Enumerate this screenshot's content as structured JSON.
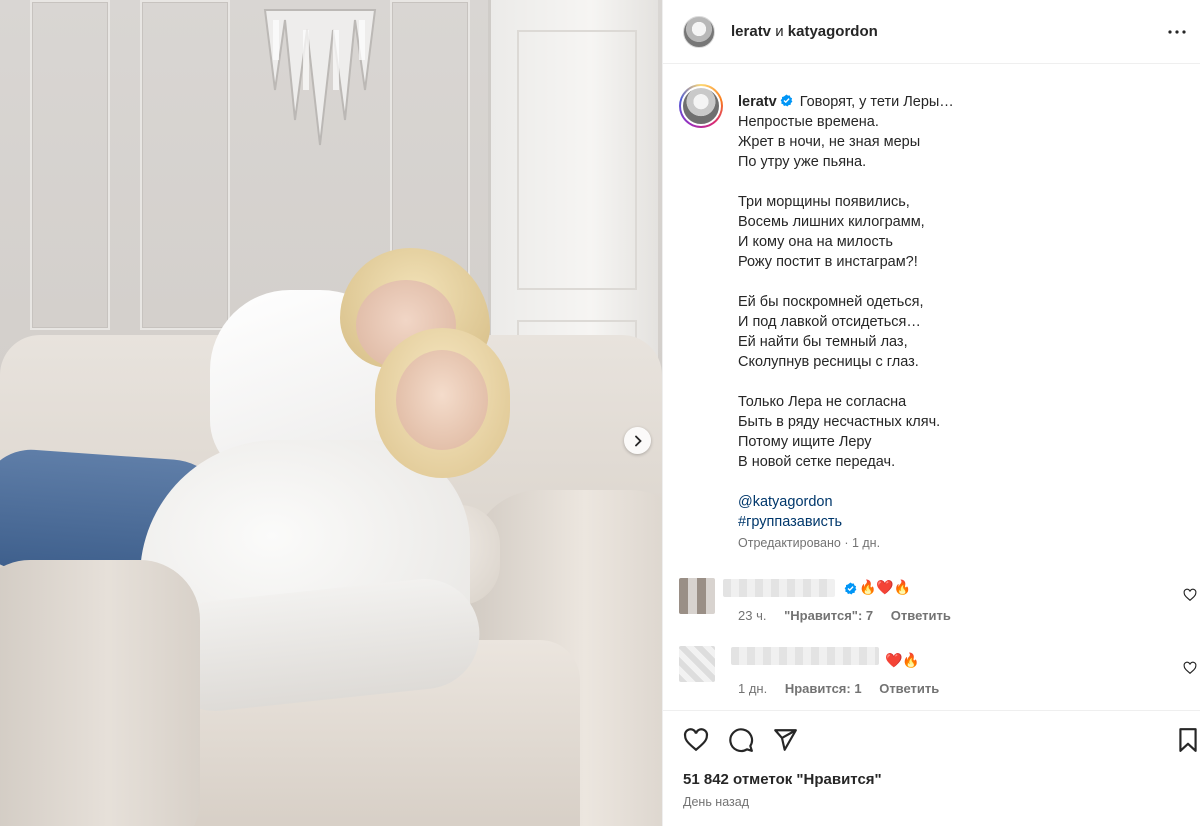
{
  "header": {
    "user1": "leratv",
    "conjunction": "и",
    "user2": "katyagordon"
  },
  "caption": {
    "username": "leratv",
    "first_line": "Говорят, у тети Леры…",
    "stanzas": [
      [
        "Непростые времена.",
        "Жрет в ночи, не зная меры",
        "По утру уже пьяна."
      ],
      [
        "Три морщины появились,",
        "Восемь лишних килограмм,",
        "И кому она на милость",
        "Рожу постит в инстаграм?!"
      ],
      [
        "Ей бы поскромней одеться,",
        "И под лавкой отсидеться…",
        "Ей найти бы темный лаз,",
        "Сколупнув ресницы с глаз."
      ],
      [
        "Только Лера не согласна",
        "Быть в ряду несчастных кляч.",
        "Потому ищите Леру",
        "В новой сетке передач."
      ]
    ],
    "mention": "@katyagordon",
    "hashtag": "#группазависть",
    "edited": "Отредактировано · 1 дн."
  },
  "comments": [
    {
      "emoji": "🔥❤️🔥",
      "time": "23 ч.",
      "likes": "\"Нравится\": 7",
      "reply": "Ответить"
    },
    {
      "emoji": "❤️🔥",
      "time": "1 дн.",
      "likes": "Нравится: 1",
      "reply": "Ответить"
    }
  ],
  "footer": {
    "likes": "51 842 отметок \"Нравится\"",
    "date": "День назад"
  },
  "icons": [
    "more-icon",
    "verified-icon",
    "heart-icon",
    "comment-icon",
    "share-icon",
    "bookmark-icon",
    "chevron-right-icon"
  ],
  "colors": {
    "link": "#00376b",
    "verified": "#0095f6",
    "muted": "#737373"
  }
}
